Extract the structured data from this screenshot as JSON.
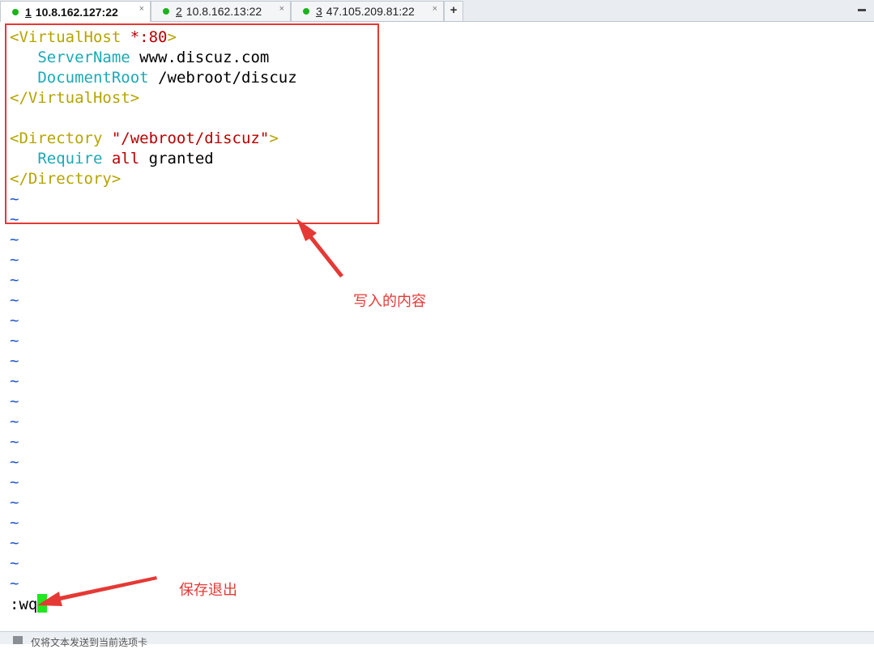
{
  "tabs": [
    {
      "num": "1",
      "label": "10.8.162.127:22",
      "active": true
    },
    {
      "num": "2",
      "label": "10.8.162.13:22",
      "active": false
    },
    {
      "num": "3",
      "label": "47.105.209.81:22",
      "active": false
    }
  ],
  "tab_close_glyph": "×",
  "add_tab_glyph": "+",
  "menu_glyph": "▬",
  "editor": {
    "l1": {
      "open": "<VirtualHost",
      "star": "*:80",
      "close": ">"
    },
    "l2": {
      "key": "ServerName",
      "val": "www.discuz.com"
    },
    "l3": {
      "key": "DocumentRoot",
      "val": "/webroot/discuz"
    },
    "l4": "</VirtualHost>",
    "l6": {
      "open": "<Directory",
      "path": "\"/webroot/discuz\"",
      "close": ">"
    },
    "l7": {
      "key": "Require",
      "all": "all",
      "val": "granted"
    },
    "l8": "</Directory>",
    "tilde": "~",
    "command": ":wq"
  },
  "annotations": {
    "written": "写入的内容",
    "save_exit": "保存退出"
  },
  "status": {
    "text": "仅将文本发送到当前选项卡"
  },
  "colors": {
    "tag": "#b5a400",
    "string": "#b80000",
    "keyword": "#1ba9b6",
    "tilde": "#1f55c8",
    "cursor": "#1ee81e",
    "annotation": "#e53935",
    "status_dot": "#1cb31c"
  }
}
